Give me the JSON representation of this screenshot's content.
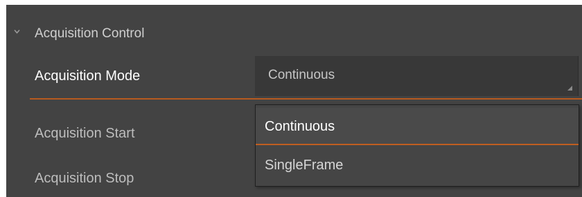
{
  "section": {
    "title": "Acquisition Control",
    "caret_icon": "chevron-down-icon"
  },
  "rows": [
    {
      "label": "Acquisition Mode",
      "state": "active"
    },
    {
      "label": "Acquisition Start",
      "state": "normal"
    },
    {
      "label": "Acquisition Stop",
      "state": "normal"
    }
  ],
  "acquisition_mode": {
    "value": "Continuous",
    "options": [
      {
        "label": "Continuous",
        "selected": true
      },
      {
        "label": "SingleFrame",
        "selected": false
      }
    ]
  },
  "colors": {
    "panel_bg": "#434343",
    "value_box_bg": "#383838",
    "accent": "#b85a1f",
    "text_active": "#ffffff",
    "text_dim": "#bdbdbd"
  }
}
